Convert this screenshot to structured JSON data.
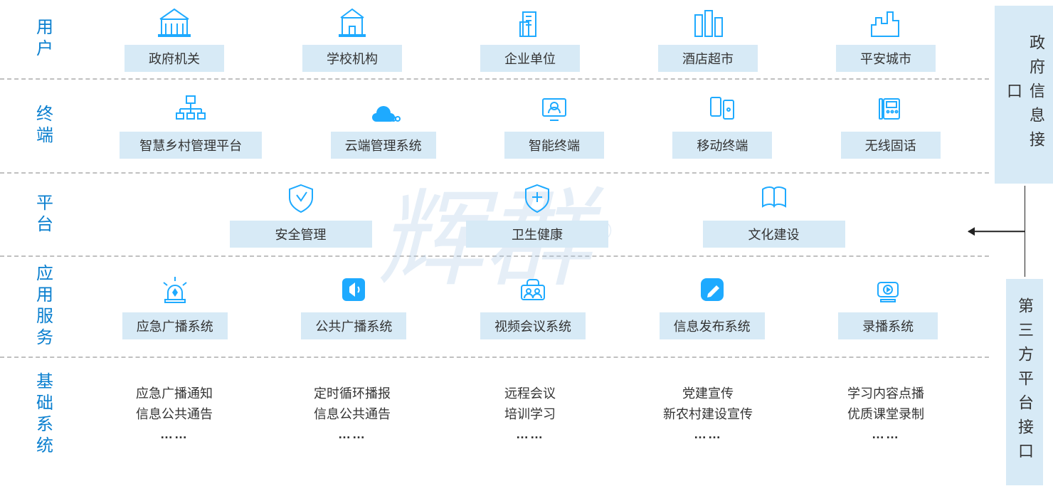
{
  "rows": {
    "users": {
      "label": "用户",
      "items": [
        {
          "label": "政府机关",
          "icon": "government-building-icon"
        },
        {
          "label": "学校机构",
          "icon": "school-building-icon"
        },
        {
          "label": "企业单位",
          "icon": "office-building-icon"
        },
        {
          "label": "酒店超市",
          "icon": "hotel-buildings-icon"
        },
        {
          "label": "平安城市",
          "icon": "city-skyline-icon"
        }
      ]
    },
    "terminals": {
      "label": "终端",
      "items": [
        {
          "label": "智慧乡村管理平台",
          "icon": "network-nodes-icon"
        },
        {
          "label": "云端管理系统",
          "icon": "cloud-users-icon"
        },
        {
          "label": "智能终端",
          "icon": "monitor-user-icon"
        },
        {
          "label": "移动终端",
          "icon": "mobile-devices-icon"
        },
        {
          "label": "无线固话",
          "icon": "desk-phone-icon"
        }
      ]
    },
    "platform": {
      "label": "平台",
      "items": [
        {
          "label": "安全管理",
          "icon": "shield-icon"
        },
        {
          "label": "卫生健康",
          "icon": "medical-shield-icon"
        },
        {
          "label": "文化建设",
          "icon": "book-icon"
        }
      ]
    },
    "appservices": {
      "label": "应用服务",
      "items": [
        {
          "label": "应急广播系统",
          "icon": "alarm-light-icon"
        },
        {
          "label": "公共广播系统",
          "icon": "speaker-icon"
        },
        {
          "label": "视频会议系统",
          "icon": "conference-icon"
        },
        {
          "label": "信息发布系统",
          "icon": "edit-note-icon"
        },
        {
          "label": "录播系统",
          "icon": "camera-record-icon"
        }
      ]
    },
    "basesystem": {
      "label": "基础系统",
      "items": [
        {
          "line1": "应急广播通知",
          "line2": "信息公共通告",
          "line3": "……"
        },
        {
          "line1": "定时循环播报",
          "line2": "信息公共通告",
          "line3": "……"
        },
        {
          "line1": "远程会议",
          "line2": "培训学习",
          "line3": "……"
        },
        {
          "line1": "党建宣传",
          "line2": "新农村建设宣传",
          "line3": "……"
        },
        {
          "line1": "学习内容点播",
          "line2": "优质课堂录制",
          "line3": "……"
        }
      ]
    }
  },
  "right": {
    "top": "政府信息接口",
    "bottom": "第三方平台接口"
  },
  "watermark": "辉群",
  "watermark_mark": "®"
}
